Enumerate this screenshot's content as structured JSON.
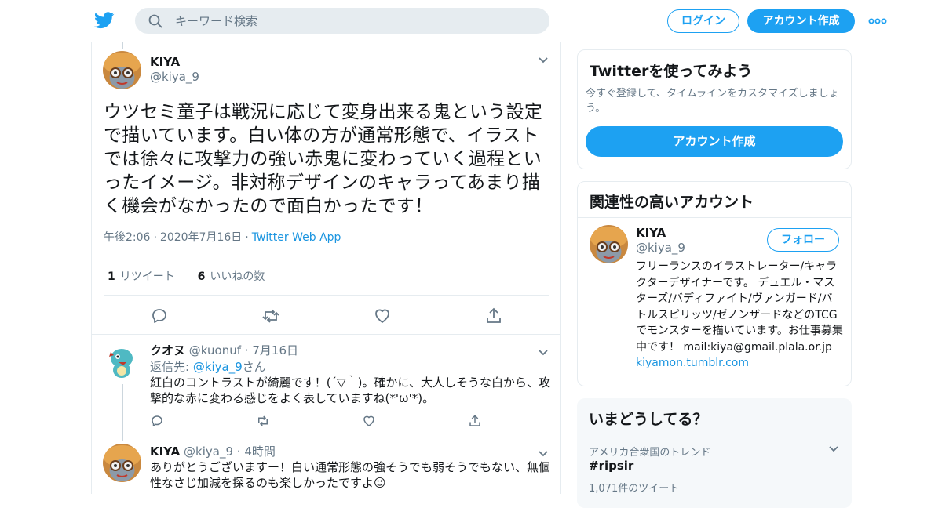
{
  "header": {
    "search_placeholder": "キーワード検索",
    "login_label": "ログイン",
    "signup_label": "アカウント作成",
    "brand_color": "#1da1f2"
  },
  "main_tweet": {
    "name": "KIYA",
    "handle": "@kiya_9",
    "text": "ウツセミ童子は戦況に応じて変身出来る鬼という設定で描いています。白い体の方が通常形態で、イラストでは徐々に攻撃力の強い赤鬼に変わっていく過程といったイメージ。非対称デザインのキャラってあまり描く機会がなかったので面白かったです！",
    "time": "午後2:06",
    "date": "2020年7月16日",
    "source": "Twitter Web App",
    "retweet_count": "1",
    "retweet_label": "リツイート",
    "like_count": "6",
    "like_label": "いいねの数"
  },
  "replies": [
    {
      "name": "クオヌ",
      "handle": "@kuonuf",
      "time": "7月16日",
      "reply_to_prefix": "返信先: ",
      "reply_to_handle": "@kiya_9",
      "reply_to_suffix": "さん",
      "text": "紅白のコントラストが綺麗です！(´▽｀)。確かに、大人しそうな白から、攻撃的な赤に変わる感じをよく表していますね(*'ω'*)。"
    },
    {
      "name": "KIYA",
      "handle": "@kiya_9",
      "time": "4時間",
      "text": "ありがとうございますー！白い通常形態の強そうでも弱そうでもない、無個性なさじ加減を探るのも楽しかったですよ😉"
    }
  ],
  "sidebar": {
    "signup_card": {
      "title": "Twitterを使ってみよう",
      "desc": "今すぐ登録して、タイムラインをカスタマイズしましょう。",
      "button": "アカウント作成"
    },
    "related": {
      "title": "関連性の高いアカウント",
      "name": "KIYA",
      "handle": "@kiya_9",
      "follow_label": "フォロー",
      "bio": "フリーランスのイラストレーター/キャラクターデザイナーです。 デュエル・マスターズ/バディファイト/ヴァンガード/バトルスピリッツ/ゼノンザードなどのTCGでモンスターを描いています。お仕事募集中です！ mail:kiya@gmail.plala.or.jp",
      "link": "kiyamon.tumblr.com"
    },
    "trends": {
      "title": "いまどうしてる？",
      "context": "アメリカ合衆国のトレンド",
      "name": "#ripsir",
      "count": "1,071件のツイート"
    }
  }
}
